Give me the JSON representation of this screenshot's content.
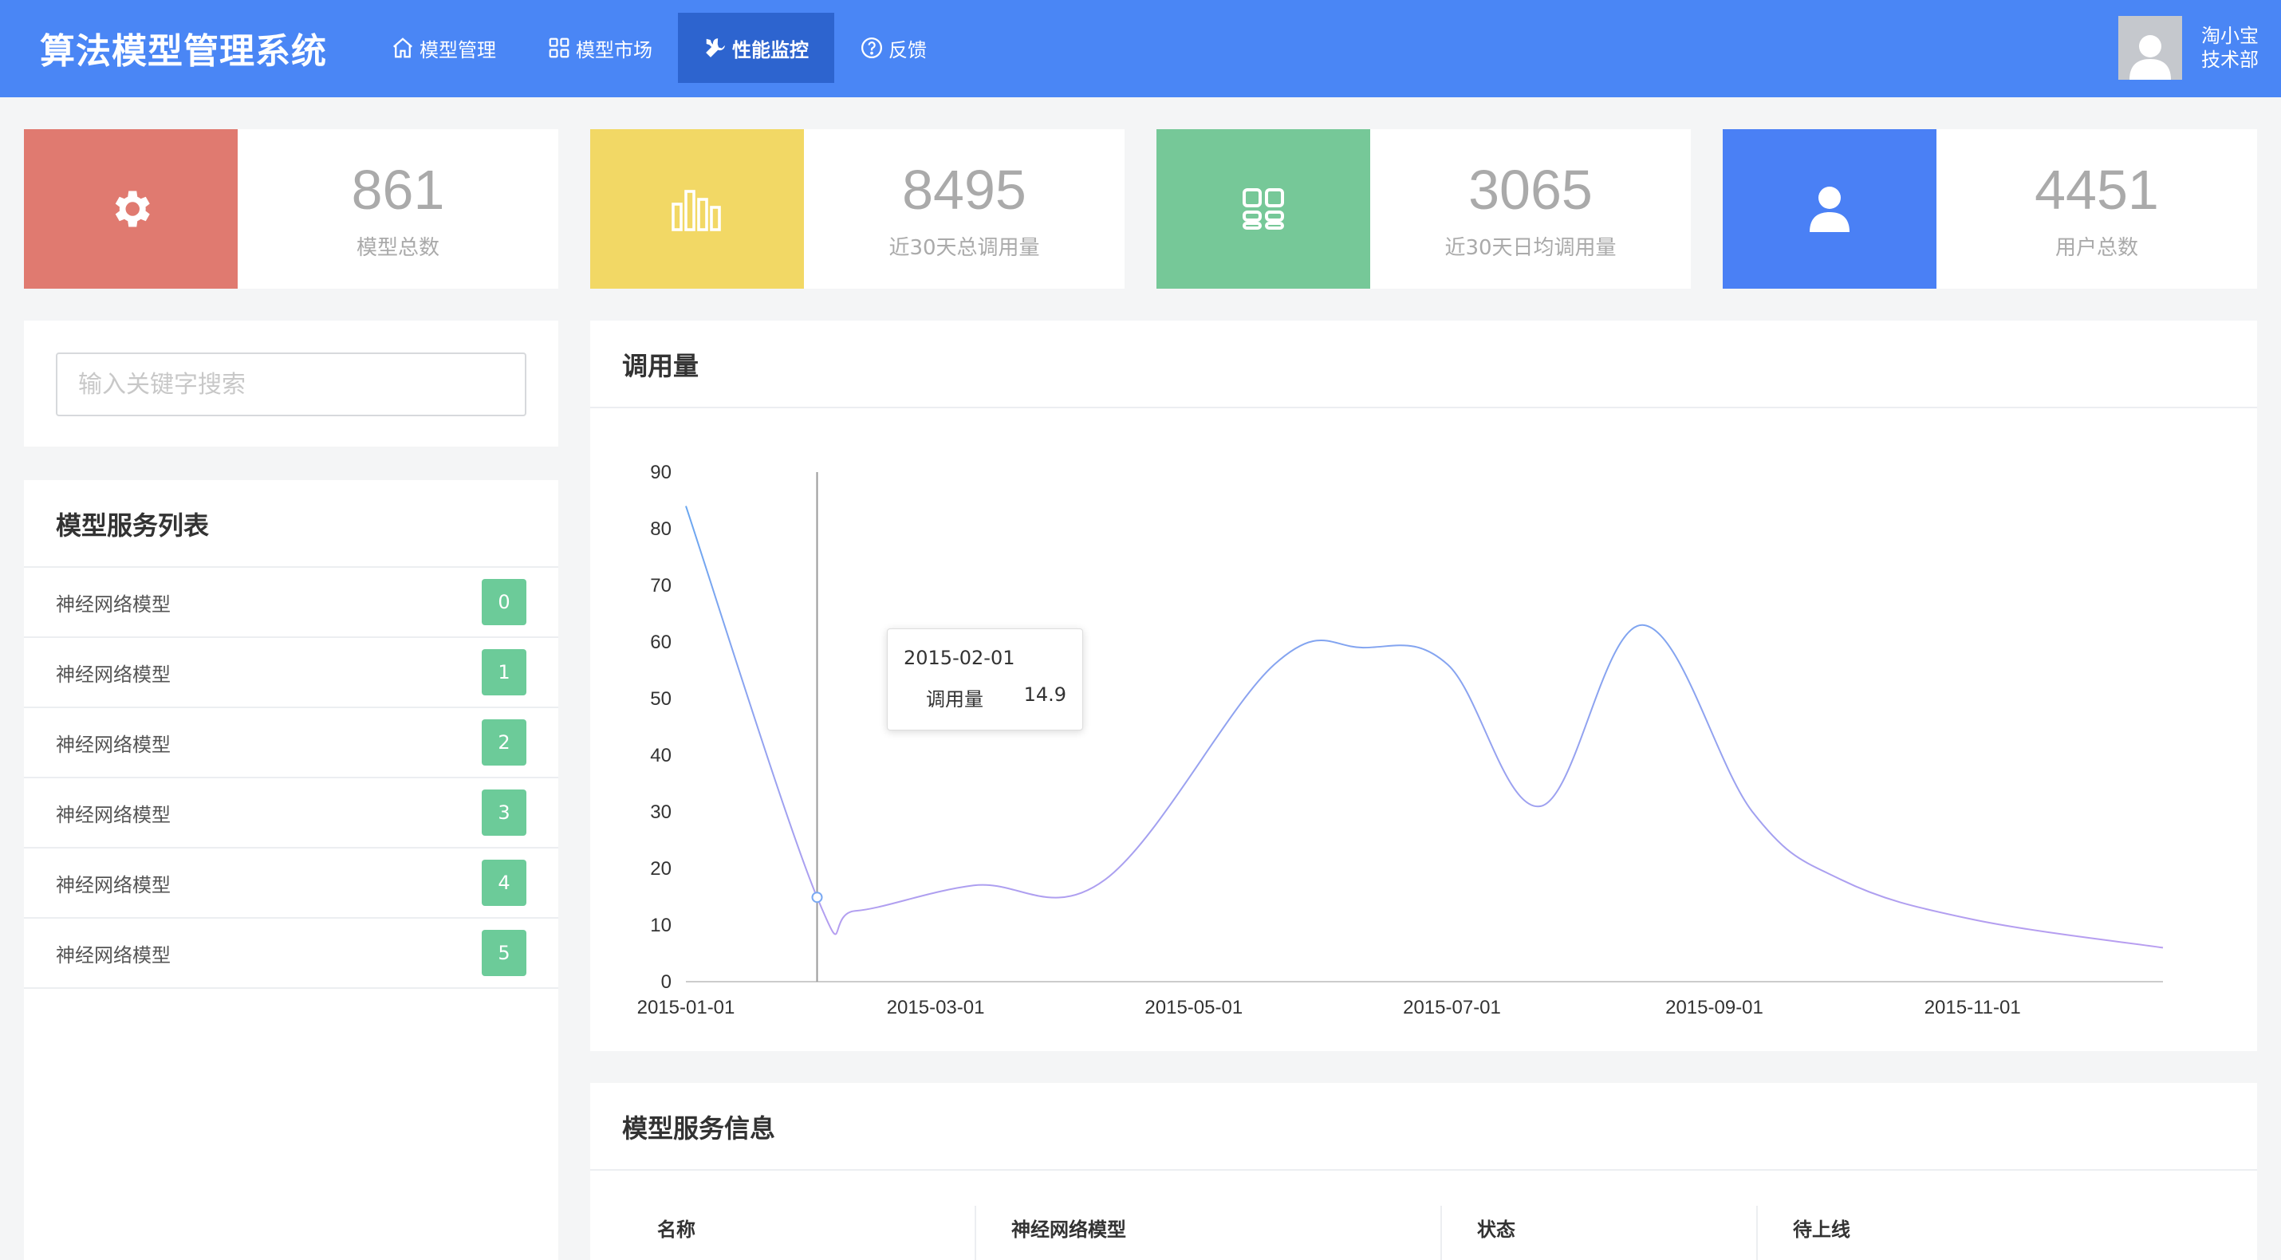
{
  "app": {
    "title": "算法模型管理系统"
  },
  "nav": {
    "items": [
      {
        "label": "模型管理",
        "icon": "home-icon"
      },
      {
        "label": "模型市场",
        "icon": "grid-icon"
      },
      {
        "label": "性能监控",
        "icon": "tools-icon",
        "active": true
      },
      {
        "label": "反馈",
        "icon": "help-circle-icon"
      }
    ]
  },
  "user": {
    "name": "淘小宝",
    "dept": "技术部"
  },
  "stats": [
    {
      "value": "861",
      "label": "模型总数",
      "color": "#e07a70",
      "icon": "gear-icon"
    },
    {
      "value": "8495",
      "label": "近30天总调用量",
      "color": "#f2d865",
      "icon": "bar-chart-icon"
    },
    {
      "value": "3065",
      "label": "近30天日均调用量",
      "color": "#76c898",
      "icon": "apps-icon"
    },
    {
      "value": "4451",
      "label": "用户总数",
      "color": "#4a80f5",
      "icon": "user-icon"
    }
  ],
  "search": {
    "placeholder": "输入关键字搜索"
  },
  "service_list": {
    "title": "模型服务列表",
    "items": [
      {
        "name": "神经网络模型",
        "badge": "0"
      },
      {
        "name": "神经网络模型",
        "badge": "1"
      },
      {
        "name": "神经网络模型",
        "badge": "2"
      },
      {
        "name": "神经网络模型",
        "badge": "3"
      },
      {
        "name": "神经网络模型",
        "badge": "4"
      },
      {
        "name": "神经网络模型",
        "badge": "5"
      }
    ]
  },
  "usage_panel": {
    "title": "调用量"
  },
  "tooltip": {
    "date": "2015-02-01",
    "series": "调用量",
    "value": "14.9"
  },
  "chart_data": {
    "type": "line",
    "title": "调用量",
    "series": [
      {
        "name": "调用量"
      }
    ],
    "x_tick_labels": [
      "2015-01-01",
      "2015-03-01",
      "2015-05-01",
      "2015-07-01",
      "2015-09-01",
      "2015-11-01"
    ],
    "x_range": [
      "2015-01-01",
      "2015-12-16"
    ],
    "ylim": [
      0,
      90
    ],
    "y_ticks": [
      0,
      10,
      20,
      30,
      40,
      50,
      60,
      70,
      80,
      90
    ],
    "points": [
      {
        "x": "2015-01-01",
        "y": 84
      },
      {
        "x": "2015-02-01",
        "y": 14.9
      },
      {
        "x": "2015-02-10",
        "y": 12.5
      },
      {
        "x": "2015-03-10",
        "y": 17
      },
      {
        "x": "2015-04-10",
        "y": 18
      },
      {
        "x": "2015-05-20",
        "y": 56
      },
      {
        "x": "2015-06-10",
        "y": 59
      },
      {
        "x": "2015-06-30",
        "y": 56
      },
      {
        "x": "2015-07-22",
        "y": 31
      },
      {
        "x": "2015-08-15",
        "y": 63
      },
      {
        "x": "2015-09-10",
        "y": 30
      },
      {
        "x": "2015-10-01",
        "y": 18
      },
      {
        "x": "2015-11-01",
        "y": 11
      },
      {
        "x": "2015-12-16",
        "y": 6
      }
    ],
    "gradient_colors": [
      "#b89ef0",
      "#6aa7f0"
    ],
    "grid": false
  },
  "info_panel": {
    "title": "模型服务信息",
    "row": {
      "name_label": "名称",
      "name_value": "神经网络模型",
      "status_label": "状态",
      "status_value": "待上线"
    }
  }
}
